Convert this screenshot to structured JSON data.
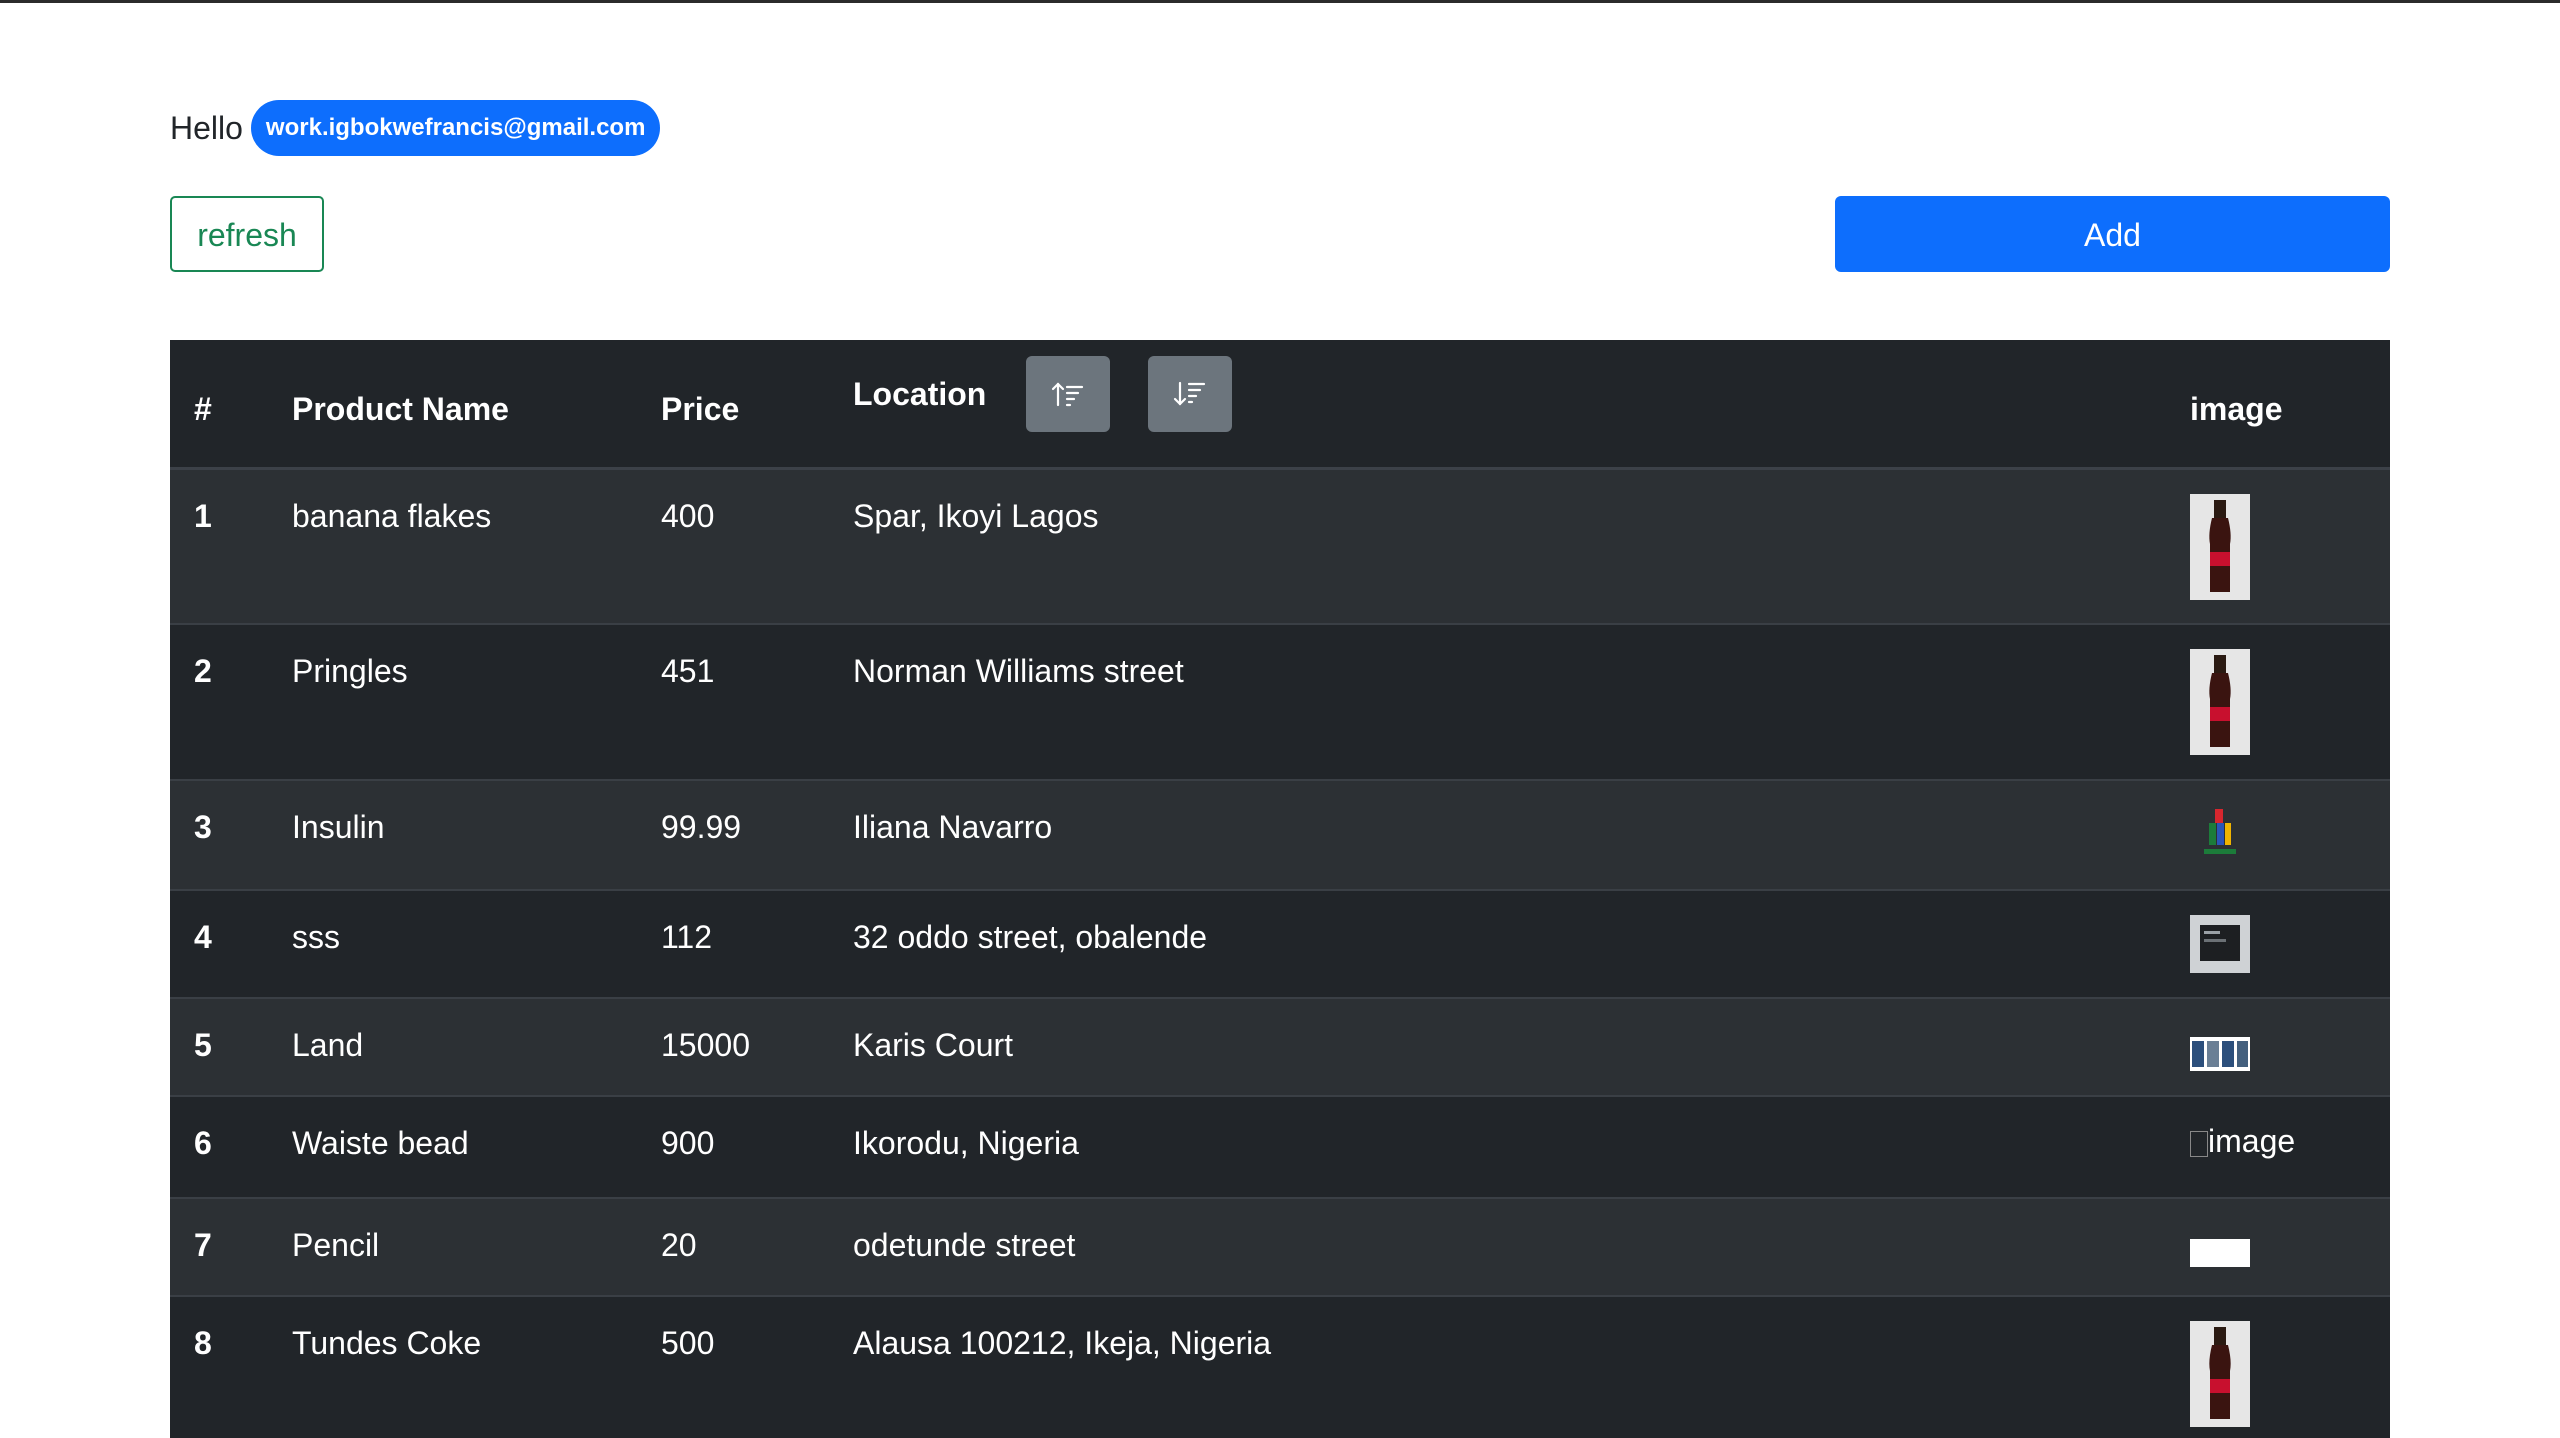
{
  "greeting": {
    "hello": "Hello",
    "email": "work.igbokwefrancis@gmail.com"
  },
  "actions": {
    "refresh_label": "refresh",
    "add_label": "Add"
  },
  "colors": {
    "primary": "#0d6efd",
    "success": "#198754",
    "table_dark": "#212529",
    "table_striped": "#2c3034",
    "sort_button": "#6c757d"
  },
  "table": {
    "headers": {
      "index": "#",
      "name": "Product Name",
      "price": "Price",
      "location": "Location",
      "image": "image"
    },
    "sort_icons": [
      "sort-ascending-icon",
      "sort-descending-icon"
    ],
    "rows": [
      {
        "index": "1",
        "name": "banana flakes",
        "price": "400",
        "location": "Spar, Ikoyi Lagos",
        "image": "coke-bottle"
      },
      {
        "index": "2",
        "name": "Pringles",
        "price": "451",
        "location": "Norman Williams street",
        "image": "coke-bottle"
      },
      {
        "index": "3",
        "name": "Insulin",
        "price": "99.99",
        "location": "Iliana Navarro",
        "image": "logo-small"
      },
      {
        "index": "4",
        "name": "sss",
        "price": "112",
        "location": "32 oddo street, obalende",
        "image": "screen-thumb"
      },
      {
        "index": "5",
        "name": "Land",
        "price": "15000",
        "location": "Karis Court",
        "image": "strip-thumb"
      },
      {
        "index": "6",
        "name": "Waiste bead",
        "price": "900",
        "location": "Ikorodu, Nigeria",
        "image": "broken",
        "image_alt": "image"
      },
      {
        "index": "7",
        "name": "Pencil",
        "price": "20",
        "location": "odetunde street",
        "image": "white-thumb"
      },
      {
        "index": "8",
        "name": "Tundes Coke",
        "price": "500",
        "location": "Alausa 100212, Ikeja, Nigeria",
        "image": "coke-bottle"
      }
    ]
  }
}
